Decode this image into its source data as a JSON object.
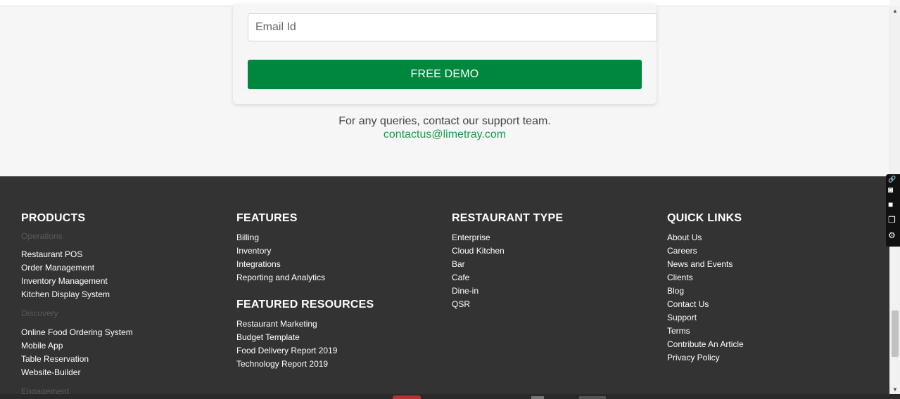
{
  "form": {
    "email_placeholder": "Email Id",
    "demo_button": "FREE DEMO"
  },
  "support": {
    "text": "For any queries, contact our support team.",
    "email": "contactus@limetray.com"
  },
  "footer": {
    "products": {
      "title": "PRODUCTS",
      "operations_label": "Operations",
      "operations": [
        "Restaurant POS",
        "Order Management",
        "Inventory Management",
        "Kitchen Display System"
      ],
      "discovery_label": "Discovery",
      "discovery": [
        "Online Food Ordering System",
        "Mobile App",
        "Table Reservation",
        "Website-Builder"
      ],
      "engagement_label": "Engagement"
    },
    "features": {
      "title": "FEATURES",
      "items": [
        "Billing",
        "Inventory",
        "Integrations",
        "Reporting and Analytics"
      ]
    },
    "featured_resources": {
      "title": "FEATURED RESOURCES",
      "items": [
        "Restaurant Marketing",
        "Budget Template",
        "Food Delivery Report 2019",
        "Technology Report 2019"
      ]
    },
    "restaurant_type": {
      "title": "RESTAURANT TYPE",
      "items": [
        "Enterprise",
        "Cloud Kitchen",
        "Bar",
        "Cafe",
        "Dine-in",
        "QSR"
      ]
    },
    "quick_links": {
      "title": "QUICK LINKS",
      "items": [
        "About Us",
        "Careers",
        "News and Events",
        "Clients",
        "Blog",
        "Contact Us",
        "Support",
        "Terms",
        "Contribute An Article",
        "Privacy Policy"
      ]
    }
  },
  "colors": {
    "accent_green": "#00873e",
    "link_green": "#1a9b4f",
    "footer_bg": "#333333"
  },
  "icons": [
    "link-icon",
    "camera-icon",
    "video-icon",
    "screens-icon",
    "gear-icon"
  ]
}
